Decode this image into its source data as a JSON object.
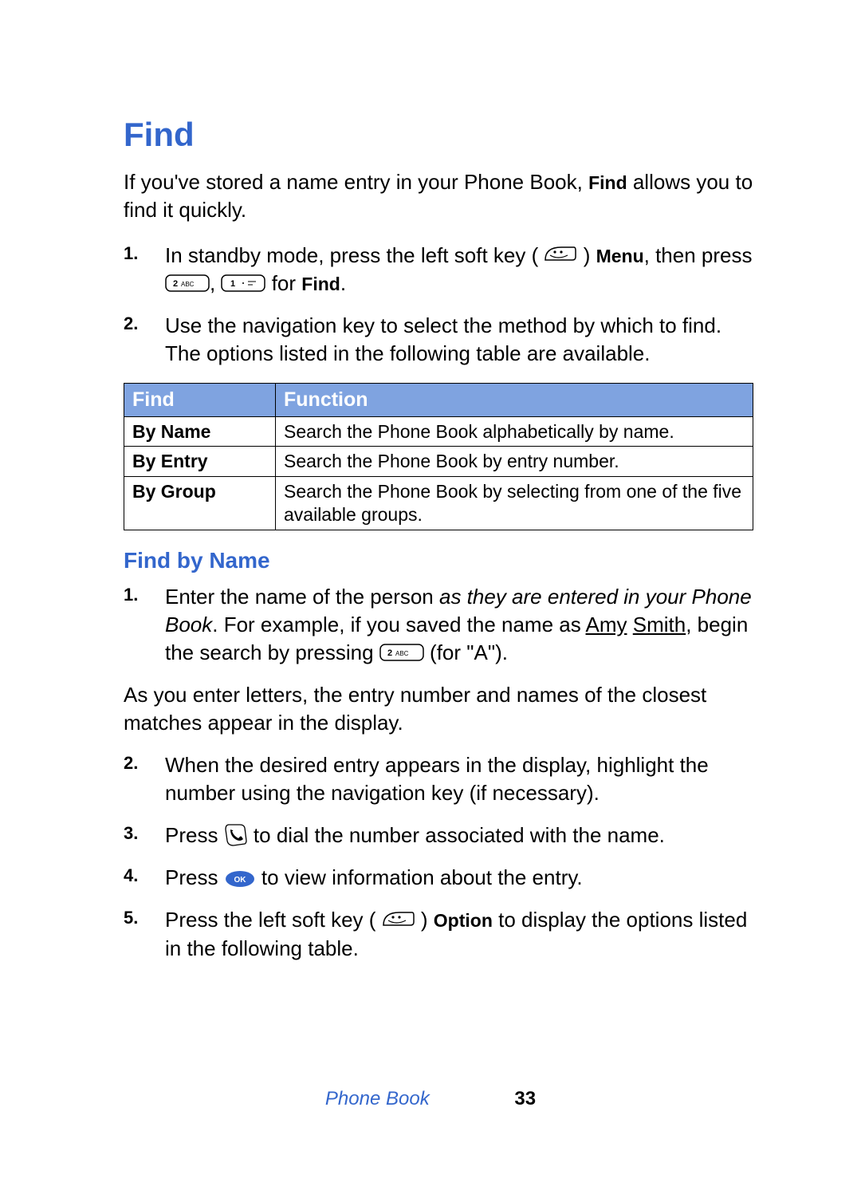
{
  "title": "Find",
  "intro_part1": "If you've stored a name entry in your Phone Book, ",
  "intro_bold": "Find",
  "intro_part2": " allows you to find it quickly.",
  "steps1": {
    "s1": {
      "num": "1.",
      "a": "In standby mode, press the left soft key ( ",
      "b": " ) ",
      "menu": "Menu",
      "c": ", then press ",
      "d": ", ",
      "e": " for ",
      "find": "Find",
      "f": "."
    },
    "s2": {
      "num": "2.",
      "text": "Use the navigation key to select the method by which to find. The options listed in the following table are available."
    }
  },
  "table": {
    "h1": "Find",
    "h2": "Function",
    "r1": {
      "label": "By Name",
      "desc": "Search the Phone Book alphabetically by name."
    },
    "r2": {
      "label": "By Entry",
      "desc": "Search the Phone Book by entry number."
    },
    "r3": {
      "label": "By Group",
      "desc": "Search the Phone Book by selecting from one of the five available groups."
    }
  },
  "subheading": "Find by Name",
  "steps2": {
    "s1": {
      "num": "1.",
      "a": "Enter the name of the person ",
      "italic": "as they are entered in your Phone Book",
      "b": ". For example, if you saved the name as ",
      "u1": "Amy",
      "sp": " ",
      "u2": "Smith",
      "c": ", begin the search by pressing ",
      "d": " (for \"A\")."
    }
  },
  "midtext": "As you enter letters, the entry number and names of the closest matches appear in the display.",
  "steps3": {
    "s2": {
      "num": "2.",
      "text": "When the desired entry appears in the display, highlight the number using the navigation key (if necessary)."
    },
    "s3": {
      "num": "3.",
      "a": "Press ",
      "b": " to dial the number associated with the name."
    },
    "s4": {
      "num": "4.",
      "a": "Press ",
      "b": " to view information about the entry."
    },
    "s5": {
      "num": "5.",
      "a": "Press the left soft key ( ",
      "b": " ) ",
      "opt": "Option",
      "c": " to display the options listed in the following table."
    }
  },
  "footer": {
    "section": "Phone Book",
    "page": "33"
  }
}
